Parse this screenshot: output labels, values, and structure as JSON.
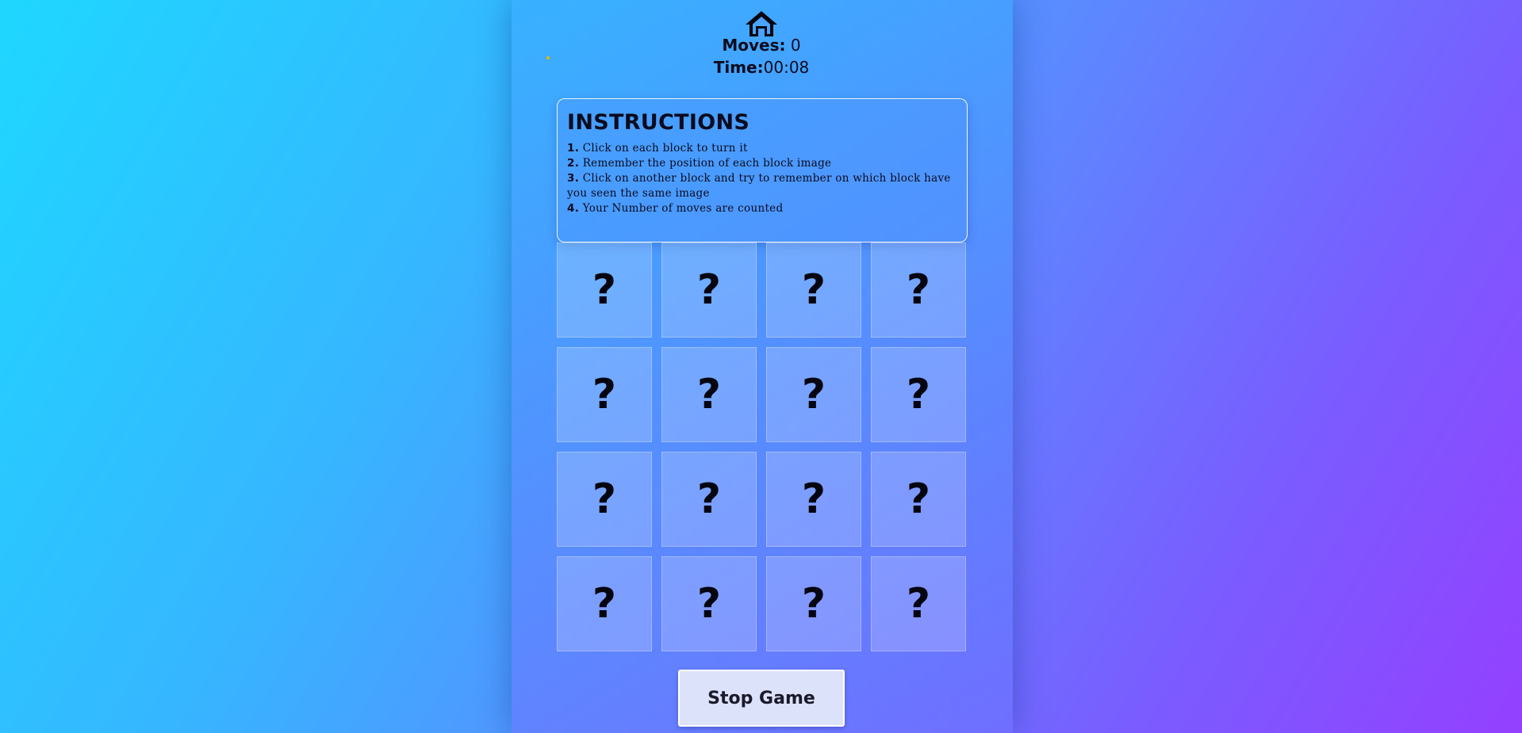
{
  "header": {
    "home_icon": "home-icon",
    "moves_label": "Moves:",
    "moves_value": "0",
    "time_label": "Time:",
    "time_value": "00:08"
  },
  "instructions": {
    "title": "INSTRUCTIONS",
    "items": [
      {
        "num": "1.",
        "text": "Click on each block to turn it"
      },
      {
        "num": "2.",
        "text": "Remember the position of each block image"
      },
      {
        "num": "3.",
        "text": "Click on another block and try to remember on which block have you seen the same image"
      },
      {
        "num": "4.",
        "text": "Your Number of moves are counted"
      }
    ]
  },
  "board": {
    "cards": [
      "?",
      "?",
      "?",
      "?",
      "?",
      "?",
      "?",
      "?",
      "?",
      "?",
      "?",
      "?",
      "?",
      "?",
      "?",
      "?"
    ]
  },
  "controls": {
    "stop_label": "Stop Game"
  },
  "colors": {
    "background_start": "#1ed7ff",
    "background_end": "#9440ff",
    "text": "#0b0b1e",
    "button_bg": "#dde2fb"
  }
}
